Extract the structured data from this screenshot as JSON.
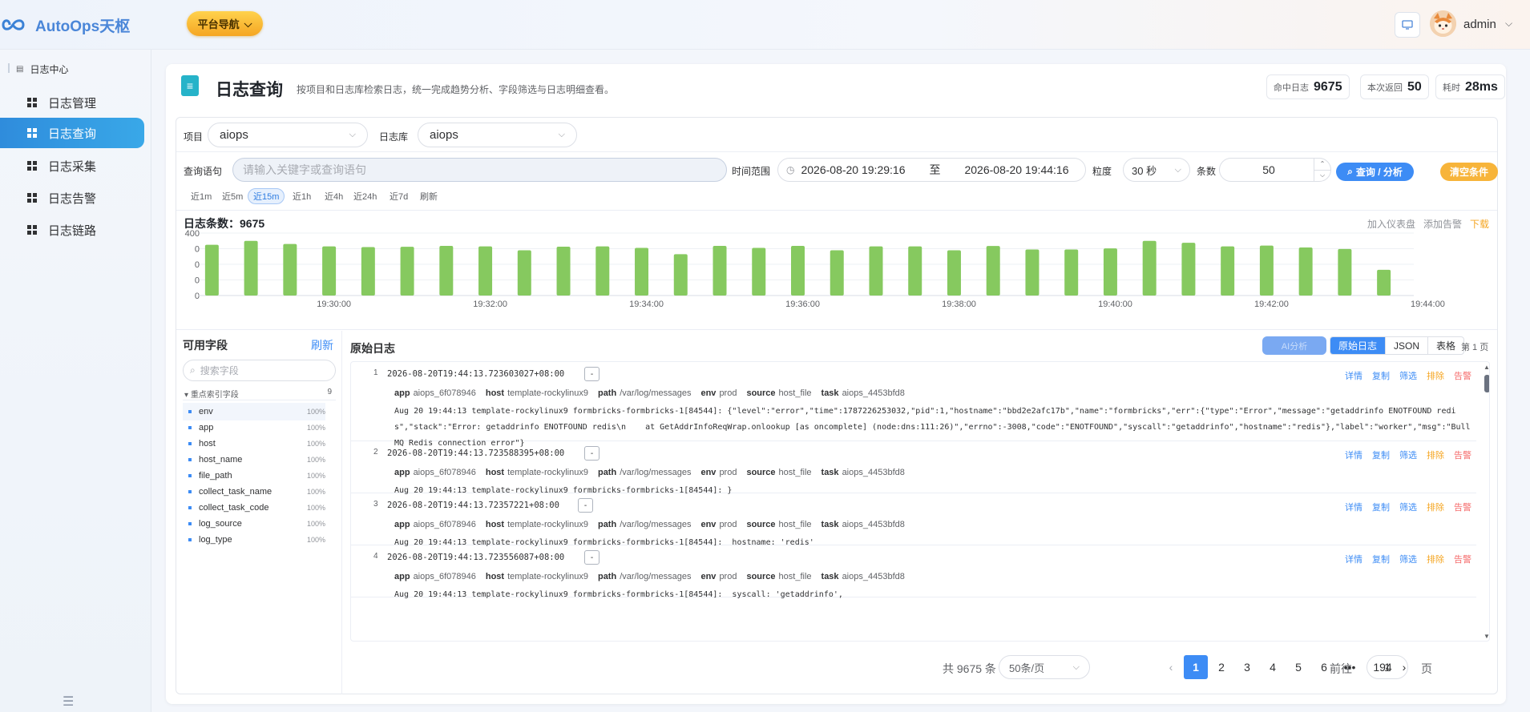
{
  "app": {
    "title": "AutoOps天枢"
  },
  "topbar": {
    "nav_button": "平台导航",
    "username": "admin"
  },
  "sidebar": {
    "group": "日志中心",
    "items": [
      {
        "label": "日志管理",
        "active": false
      },
      {
        "label": "日志查询",
        "active": true
      },
      {
        "label": "日志采集",
        "active": false
      },
      {
        "label": "日志告警",
        "active": false
      },
      {
        "label": "日志链路",
        "active": false
      }
    ]
  },
  "header": {
    "title": "日志查询",
    "description": "按项目和日志库检索日志，统一完成趋势分析、字段筛选与日志明细查看。",
    "stats": [
      {
        "label": "命中日志",
        "value": "9675"
      },
      {
        "label": "本次返回",
        "value": "50"
      },
      {
        "label": "耗时",
        "value": "28ms"
      }
    ]
  },
  "filters": {
    "project_label": "项目",
    "project_value": "aiops",
    "logstore_label": "日志库",
    "logstore_value": "aiops",
    "query_label": "查询语句",
    "query_placeholder": "请输入关键字或查询语句",
    "time_label": "时间范围",
    "time_start": "2026-08-20 19:29:16",
    "time_sep": "至",
    "time_end": "2026-08-20 19:44:16",
    "granularity_label": "粒度",
    "granularity_value": "30 秒",
    "count_label": "条数",
    "count_value": "50",
    "query_button": "查询 / 分析",
    "clear_button": "清空条件",
    "quick_ranges": [
      "近1m",
      "近5m",
      "近15m",
      "近1h",
      "近4h",
      "近24h",
      "近7d",
      "刷新"
    ],
    "quick_active": "近15m"
  },
  "chart": {
    "title": "日志条数：",
    "count": "9675",
    "links": {
      "add_dashboard": "加入仪表盘",
      "add_alert": "添加告警",
      "download": "下载"
    }
  },
  "chart_data": {
    "type": "bar",
    "ylim": [
      0,
      400
    ],
    "y_ticks": [
      "400",
      "0",
      "0",
      "0",
      "0"
    ],
    "x_ticks": [
      "19:30:00",
      "19:32:00",
      "19:34:00",
      "19:36:00",
      "19:38:00",
      "19:40:00",
      "19:42:00",
      "19:44:00"
    ],
    "values": [
      325,
      350,
      330,
      315,
      310,
      312,
      318,
      315,
      290,
      313,
      315,
      305,
      265,
      318,
      305,
      318,
      290,
      315,
      315,
      290,
      317,
      295,
      295,
      302,
      350,
      338,
      315,
      320,
      308,
      298,
      165
    ],
    "color": "#86c95f"
  },
  "fields_panel": {
    "title": "可用字段",
    "refresh": "刷新",
    "search_placeholder": "搜索字段",
    "group_label": "重点索引字段",
    "group_count": "9",
    "fields": [
      {
        "name": "env",
        "pct": "100%"
      },
      {
        "name": "app",
        "pct": "100%"
      },
      {
        "name": "host",
        "pct": "100%"
      },
      {
        "name": "host_name",
        "pct": "100%"
      },
      {
        "name": "file_path",
        "pct": "100%"
      },
      {
        "name": "collect_task_name",
        "pct": "100%"
      },
      {
        "name": "collect_task_code",
        "pct": "100%"
      },
      {
        "name": "log_source",
        "pct": "100%"
      },
      {
        "name": "log_type",
        "pct": "100%"
      }
    ]
  },
  "logs_panel": {
    "title": "原始日志",
    "ghost_button": "AI分析",
    "view_tabs": [
      "原始日志",
      "JSON",
      "表格"
    ],
    "view_active": "原始日志",
    "page_label": "第 1 页",
    "actions": [
      "详情",
      "复制",
      "筛选",
      "排除",
      "告警"
    ],
    "tag_keys": {
      "app": "app",
      "host": "host",
      "path": "path",
      "env": "env",
      "source": "source",
      "task": "task"
    },
    "entries": [
      {
        "num": "1",
        "ts": "2026-08-20T19:44:13.723603027+08:00",
        "app": "aiops_6f078946",
        "host": "template-rockylinux9",
        "path": "/var/log/messages",
        "env": "prod",
        "source": "host_file",
        "task": "aiops_4453bfd8",
        "msg": "Aug 20 19:44:13 template-rockylinux9 formbricks-formbricks-1[84544]: {\"level\":\"error\",\"time\":1787226253032,\"pid\":1,\"hostname\":\"bbd2e2afc17b\",\"name\":\"formbricks\",\"err\":{\"type\":\"Error\",\"message\":\"getaddrinfo ENOTFOUND redis\",\"stack\":\"Error: getaddrinfo ENOTFOUND redis\\n    at GetAddrInfoReqWrap.onlookup [as oncomplete] (node:dns:111:26)\",\"errno\":-3008,\"code\":\"ENOTFOUND\",\"syscall\":\"getaddrinfo\",\"hostname\":\"redis\"},\"label\":\"worker\",\"msg\":\"BullMQ Redis connection error\"}"
      },
      {
        "num": "2",
        "ts": "2026-08-20T19:44:13.723588395+08:00",
        "app": "aiops_6f078946",
        "host": "template-rockylinux9",
        "path": "/var/log/messages",
        "env": "prod",
        "source": "host_file",
        "task": "aiops_4453bfd8",
        "msg": "Aug 20 19:44:13 template-rockylinux9 formbricks-formbricks-1[84544]: }"
      },
      {
        "num": "3",
        "ts": "2026-08-20T19:44:13.72357221+08:00",
        "app": "aiops_6f078946",
        "host": "template-rockylinux9",
        "path": "/var/log/messages",
        "env": "prod",
        "source": "host_file",
        "task": "aiops_4453bfd8",
        "msg": "Aug 20 19:44:13 template-rockylinux9 formbricks-formbricks-1[84544]:  hostname: 'redis'"
      },
      {
        "num": "4",
        "ts": "2026-08-20T19:44:13.723556087+08:00",
        "app": "aiops_6f078946",
        "host": "template-rockylinux9",
        "path": "/var/log/messages",
        "env": "prod",
        "source": "host_file",
        "task": "aiops_4453bfd8",
        "msg": "Aug 20 19:44:13 template-rockylinux9 formbricks-formbricks-1[84544]:  syscall: 'getaddrinfo',"
      }
    ]
  },
  "pagination": {
    "total": "共 9675 条",
    "page_size": "50条/页",
    "pages": [
      "1",
      "2",
      "3",
      "4",
      "5",
      "6",
      "•••",
      "194"
    ],
    "current": "1",
    "goto_label": "前往",
    "goto_value": "1",
    "goto_unit": "页"
  }
}
